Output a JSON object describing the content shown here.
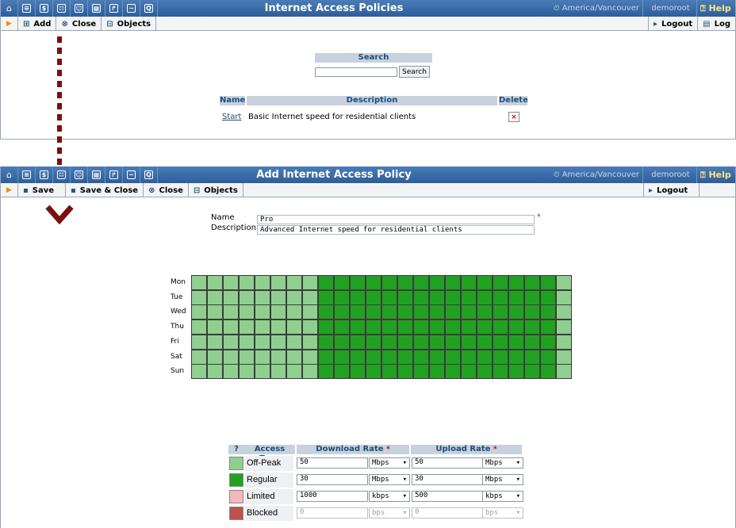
{
  "screen1": {
    "title": "Internet Access Policies",
    "timezone": "America/Vancouver",
    "user": "demoroot",
    "help": "Help",
    "toolbar": {
      "add": "Add",
      "close": "Close",
      "objects": "Objects",
      "logout": "Logout",
      "log": "Log"
    },
    "search": {
      "header": "Search",
      "button": "Search",
      "value": ""
    },
    "list": {
      "columns": [
        "Name",
        "Description",
        "Delete"
      ],
      "rows": [
        {
          "name": "Start",
          "description": "Basic Internet speed for residential clients",
          "delete": "×"
        }
      ]
    }
  },
  "screen2": {
    "title": "Add Internet Access Policy",
    "timezone": "America/Vancouver",
    "user": "demoroot",
    "help": "Help",
    "toolbar": {
      "save": "Save",
      "save_close": "Save & Close",
      "close": "Close",
      "objects": "Objects",
      "logout": "Logout"
    },
    "form": {
      "name_label": "Name",
      "name_value": "Pro",
      "description_label": "Description",
      "description_value": "Advanced Internet speed for residential clients",
      "required_mark": "*"
    },
    "schedule": {
      "days": [
        "Mon",
        "Tue",
        "Wed",
        "Thu",
        "Fri",
        "Sat",
        "Sun"
      ],
      "hours_per_day": 24,
      "regular_from_hour": 8,
      "regular_to_hour": 23,
      "colors": {
        "off_peak": "#8fcf8f",
        "regular": "#21a121"
      }
    },
    "access_types": {
      "headers": {
        "help": "?",
        "type": "Access Type",
        "download": "Download Rate",
        "upload": "Upload Rate",
        "required": "*"
      },
      "rows": [
        {
          "name": "Off-Peak",
          "color": "#8fcf8f",
          "download": "50",
          "download_unit": "Mbps",
          "upload": "50",
          "upload_unit": "Mbps",
          "disabled": false
        },
        {
          "name": "Regular",
          "color": "#21a121",
          "download": "30",
          "download_unit": "Mbps",
          "upload": "30",
          "upload_unit": "Mbps",
          "disabled": false
        },
        {
          "name": "Limited",
          "color": "#f4b8b8",
          "download": "1000",
          "download_unit": "kbps",
          "upload": "500",
          "upload_unit": "kbps",
          "disabled": false
        },
        {
          "name": "Blocked",
          "color": "#c0504d",
          "download": "0",
          "download_unit": "bps",
          "upload": "0",
          "upload_unit": "bps",
          "disabled": true
        }
      ]
    }
  }
}
